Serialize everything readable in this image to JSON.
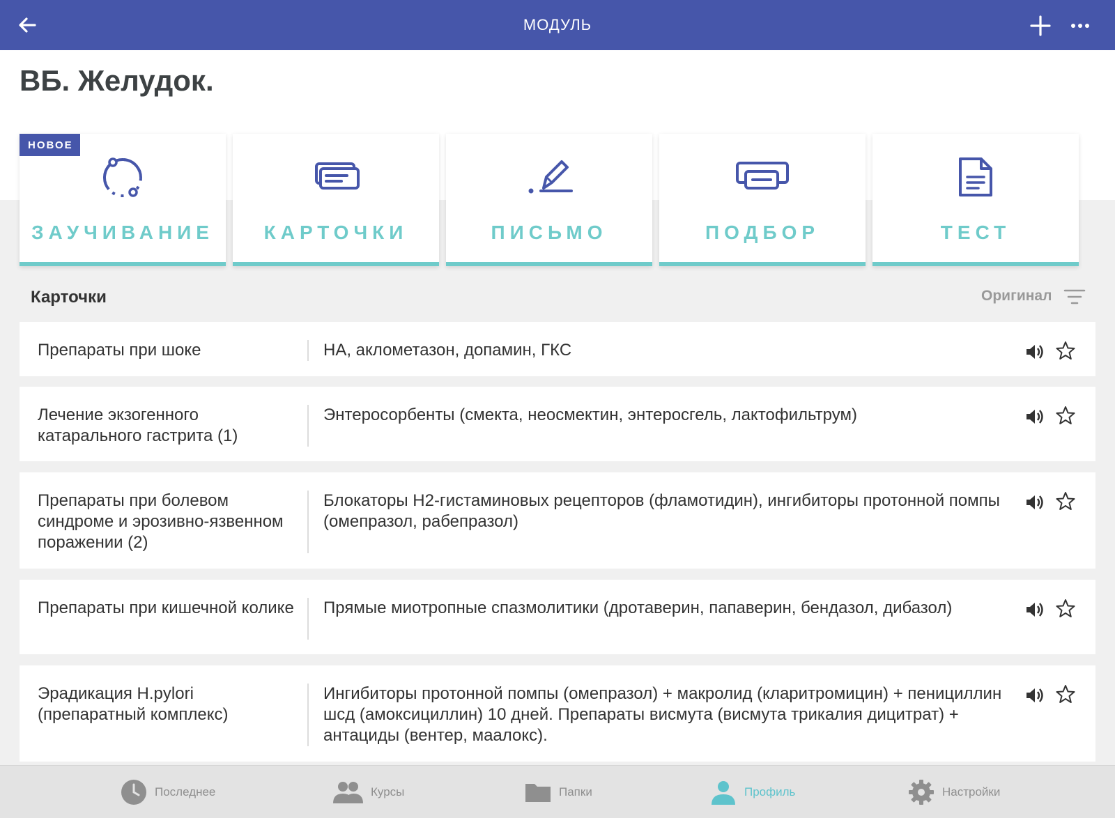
{
  "colors": {
    "topbar": "#4656aa",
    "accent": "#6fcbca",
    "badge": "#4656aa",
    "active_nav": "#5ec3cc"
  },
  "topbar": {
    "title": "МОДУЛЬ",
    "back_icon": "arrow-left-icon",
    "add_icon": "plus-icon",
    "more_icon": "more-horizontal-icon"
  },
  "page": {
    "title": "ВБ. Желудок."
  },
  "modes": [
    {
      "label": "ЗАУЧИВАНИЕ",
      "icon": "learn-cycle-icon",
      "badge": "НОВОЕ"
    },
    {
      "label": "КАРТОЧКИ",
      "icon": "cards-icon"
    },
    {
      "label": "ПИСЬМО",
      "icon": "pen-write-icon"
    },
    {
      "label": "ПОДБОР",
      "icon": "match-icon"
    },
    {
      "label": "ТЕСТ",
      "icon": "test-document-icon"
    }
  ],
  "section": {
    "title": "Карточки",
    "sort_label": "Оригинал"
  },
  "cards": [
    {
      "term": "Препараты при шоке",
      "definition": "НА, аклометазон, допамин, ГКС"
    },
    {
      "term": "Лечение экзогенного катарального гастрита (1)",
      "definition": "Энтеросорбенты (смекта, неосмектин, энтеросгель, лактофильтрум)"
    },
    {
      "term": "Препараты при болевом синдроме и эрозивно-язвенном поражении (2)",
      "definition": "Блокаторы Н2-гистаминовых рецепторов (фламотидин), ингибиторы протонной помпы (омепразол, рабепразол)"
    },
    {
      "term": "Препараты при кишечной колике",
      "definition": "Прямые миотропные спазмолитики (дротаверин, папаверин, бендазол, дибазол)"
    },
    {
      "term": "Эрадикация H.pylori (препаратный комплекс)",
      "definition": "Ингибиторы протонной помпы (омепразол) + макролид (кларитромицин) + пенициллин шсд (амоксициллин) 10 дней. Препараты висмута (висмута трикалия дицитрат) + антациды (вентер, маалокс)."
    }
  ],
  "bottom_nav": [
    {
      "label": "Последнее",
      "icon": "clock-icon"
    },
    {
      "label": "Курсы",
      "icon": "group-icon"
    },
    {
      "label": "Папки",
      "icon": "folder-icon"
    },
    {
      "label": "Профиль",
      "icon": "profile-icon",
      "active": true
    },
    {
      "label": "Настройки",
      "icon": "settings-gear-icon"
    }
  ]
}
